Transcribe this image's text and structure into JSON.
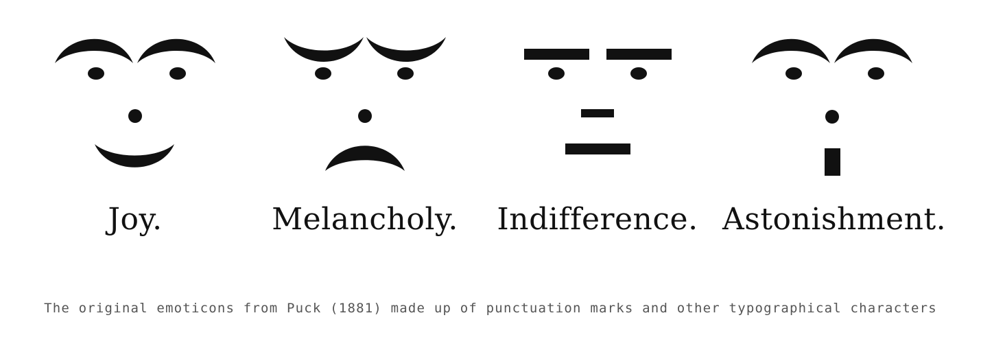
{
  "faces": [
    {
      "label": "Joy.",
      "icon": "joy-face-icon"
    },
    {
      "label": "Melancholy.",
      "icon": "melancholy-face-icon"
    },
    {
      "label": "Indifference.",
      "icon": "indifference-face-icon"
    },
    {
      "label": "Astonishment.",
      "icon": "astonishment-face-icon"
    }
  ],
  "caption": "The original emoticons from Puck (1881) made up of punctuation marks and other typographical characters",
  "colors": {
    "ink": "#111111",
    "caption": "#555555",
    "background": "#ffffff"
  }
}
